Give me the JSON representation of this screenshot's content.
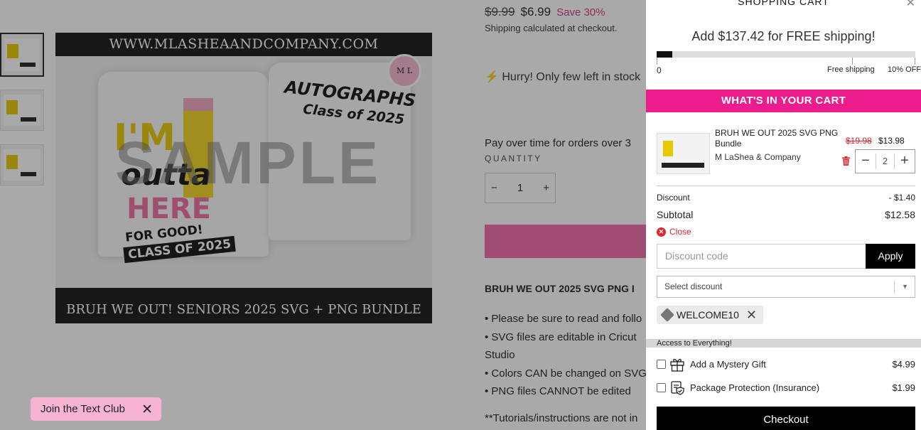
{
  "product": {
    "old_price": "$9.99",
    "new_price": "$6.99",
    "save_text": "Save 30%",
    "shipping_note": "Shipping calculated at checkout.",
    "hurry_text": "Hurry! Only few left in stock",
    "pay_over_text": "Pay over time for orders over 3",
    "quantity_label": "QUANTITY",
    "quantity_value": "1",
    "description_title": "BRUH WE OUT 2025 SVG PNG I",
    "description_items": [
      "• Please be sure to read and follo",
      "• SVG files are editable in Cricut",
      "Studio",
      "• Colors CAN be changed on SVG",
      "• PNG files CANNOT be edited"
    ],
    "tutorials_text": "**Tutorials/instructions are not in",
    "image": {
      "top_banner": "WWW.MLASHEAANDCOMPANY.COM",
      "bottom_banner": "BRUH WE OUT! SENIORS 2025 SVG + PNG BUNDLE",
      "badge": "M L",
      "watermark": "SAMPLE",
      "design_im": "I'M",
      "design_outta": "outta",
      "design_here": "HERE",
      "design_forgood": "FOR GOOD!",
      "design_class": "CLASS OF 2025",
      "design_autographs": "AUTOGRAPHS",
      "design_class2": "Class of 2025"
    }
  },
  "text_club": {
    "label": "Join the Text Club"
  },
  "cart": {
    "title": "SHOPPING CART",
    "free_shipping_message": "Add $137.42 for FREE shipping!",
    "progress_fraction": 0.06,
    "progress_start_label": "0",
    "progress_free_label": "Free shipping",
    "progress_off_label": "10% OFF",
    "section_header": "WHAT'S IN YOUR CART",
    "item": {
      "name": "BRUH WE OUT 2025 SVG PNG Bundle",
      "vendor": "M LaShea & Company",
      "old_price": "$19.98",
      "new_price": "$13.98",
      "quantity": "2"
    },
    "discount_label": "Discount",
    "discount_value": "- $1.40",
    "subtotal_label": "Subtotal",
    "subtotal_value": "$12.58",
    "close_label": "Close",
    "discount_code_placeholder": "Discount code",
    "apply_label": "Apply",
    "select_discount_placeholder": "Select discount",
    "applied_code": "WELCOME10",
    "access_text": "Access to Everything!",
    "addons": [
      {
        "label": "Add a Mystery Gift",
        "price": "$4.99"
      },
      {
        "label": "Package Protection (Insurance)",
        "price": "$1.99"
      }
    ],
    "checkout_label": "Checkout"
  },
  "colors": {
    "brand_pink": "#ec1c8c",
    "sale_red": "#e0262e",
    "button_black": "#000000"
  },
  "icons": [
    "lightning-icon",
    "trash-icon",
    "close-icon",
    "tag-icon",
    "gift-icon",
    "shield-icon",
    "chevron-down-icon"
  ]
}
